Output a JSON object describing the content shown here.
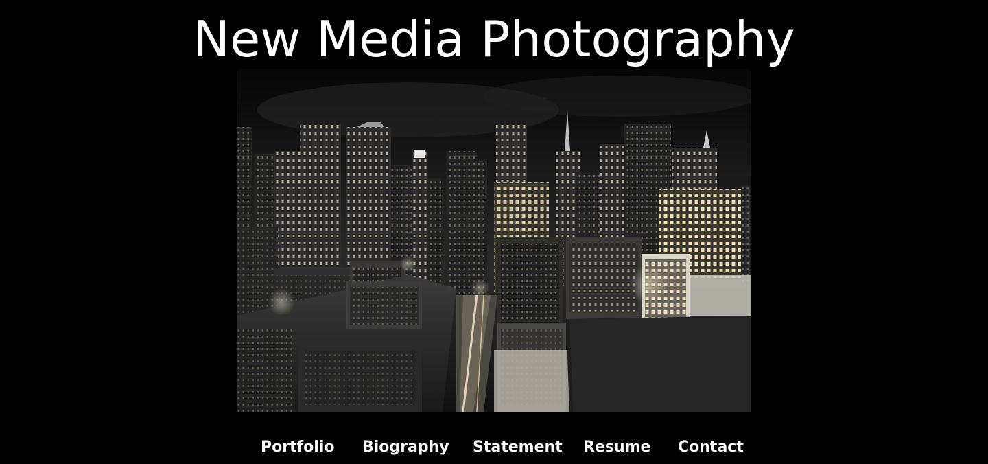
{
  "site": {
    "title": "New Media Photography"
  },
  "hero": {
    "description": "night city skyline photograph",
    "icon": "cityscape-photo"
  },
  "nav": {
    "items": [
      {
        "label": "Portfolio"
      },
      {
        "label": "Biography"
      },
      {
        "label": "Statement"
      },
      {
        "label": "Resume"
      },
      {
        "label": "Contact"
      }
    ]
  },
  "colors": {
    "background": "#000000",
    "text": "#ffffff"
  }
}
